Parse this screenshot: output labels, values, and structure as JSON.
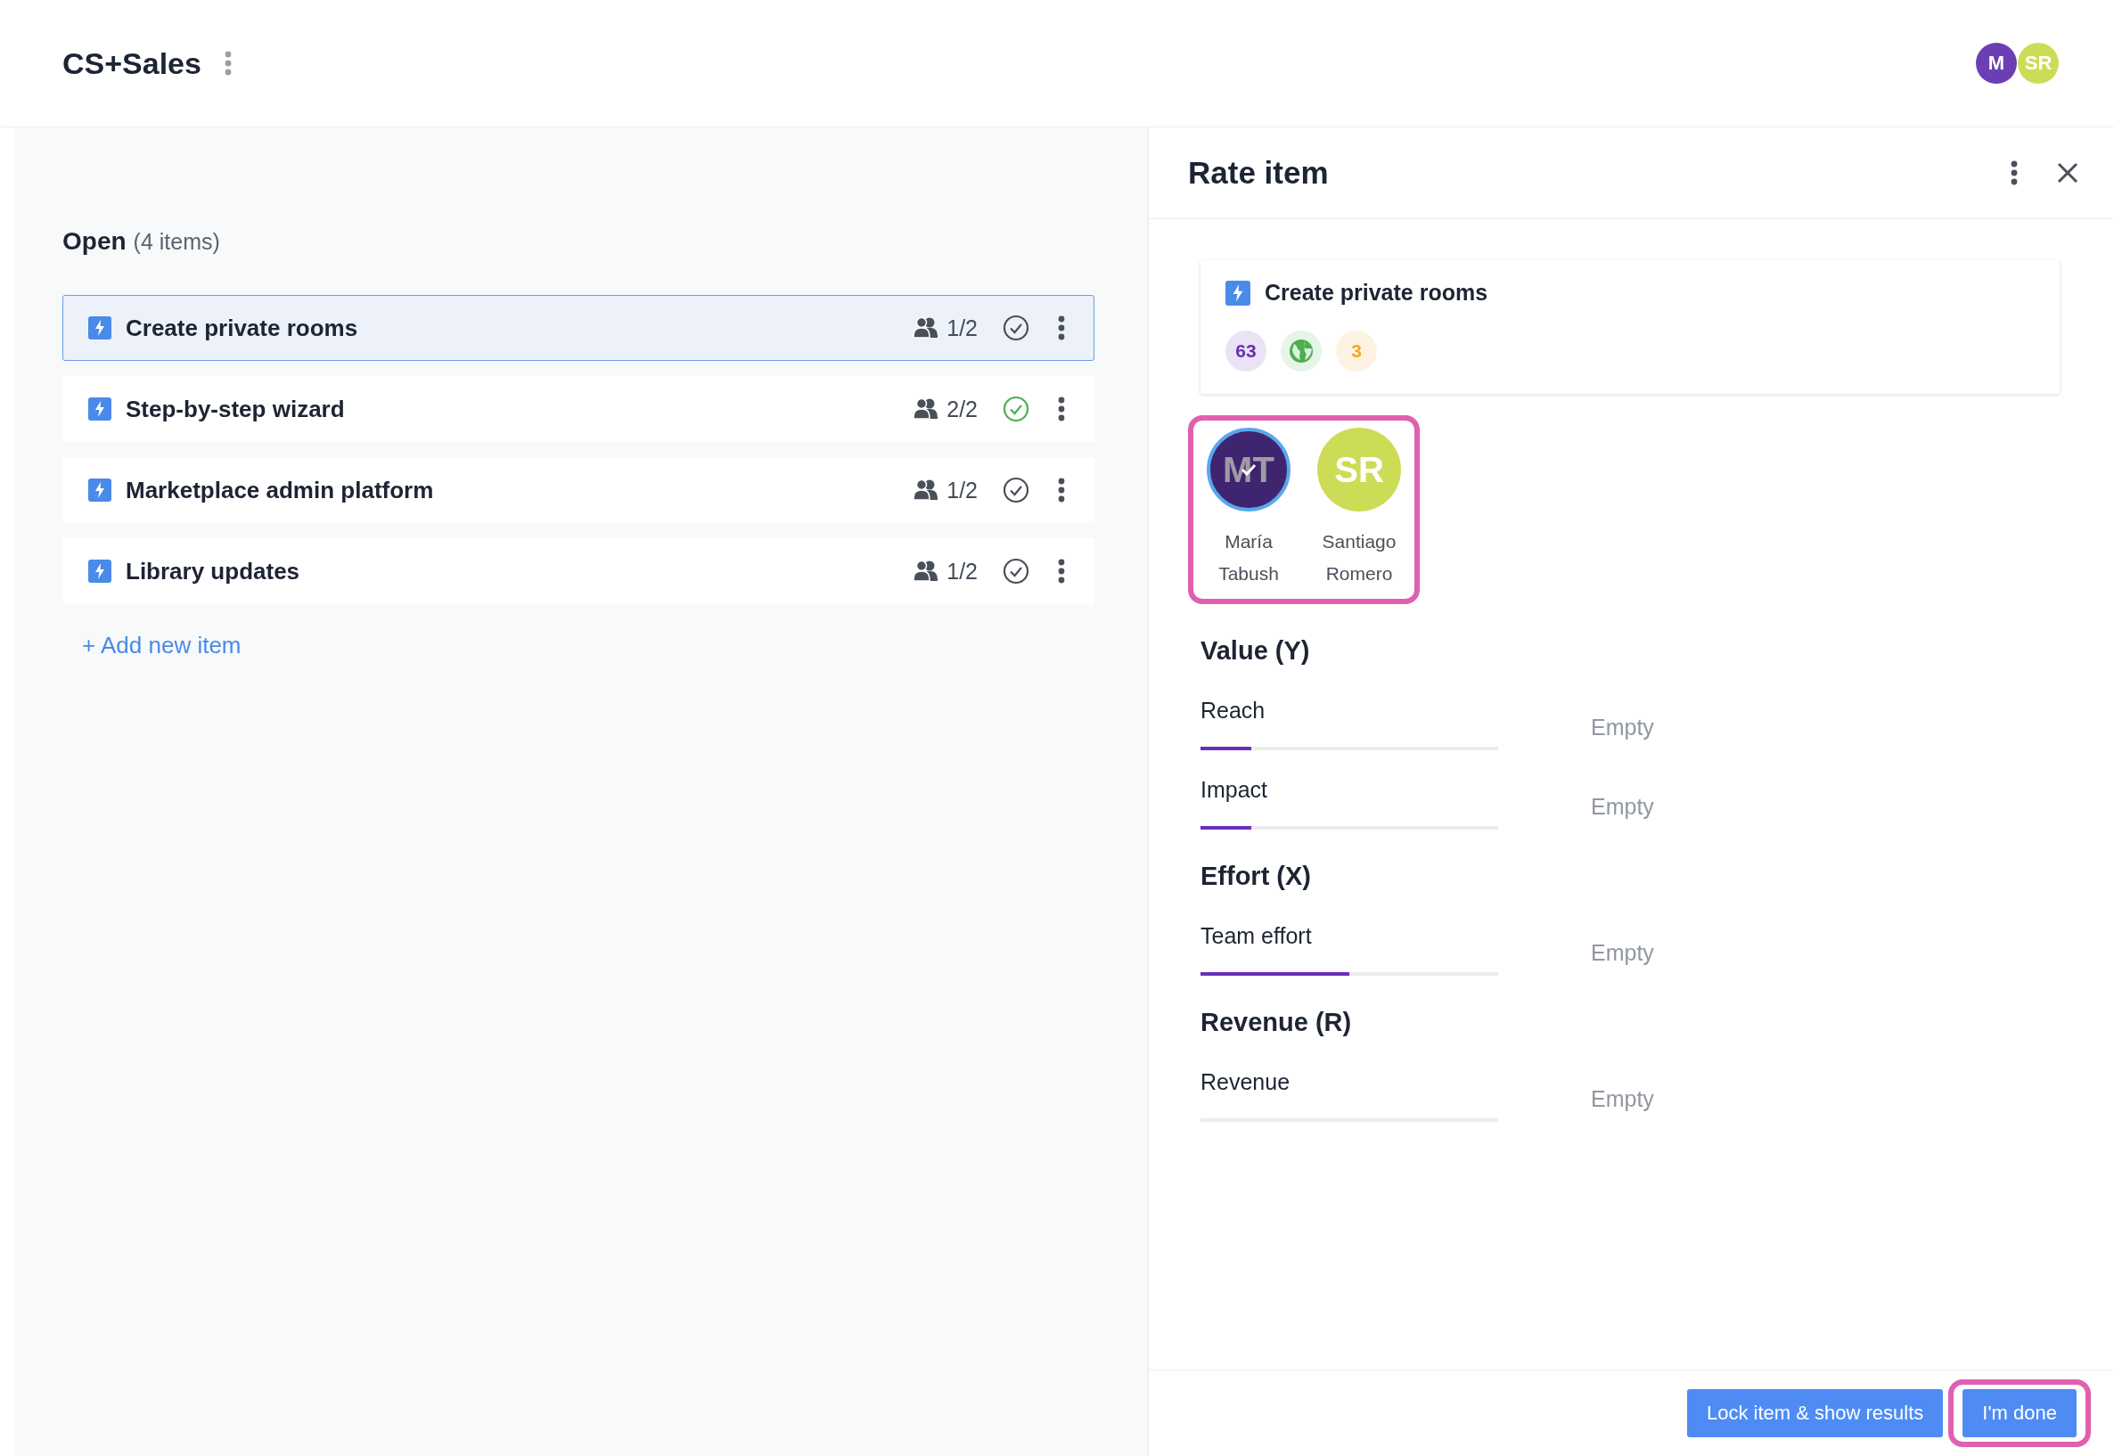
{
  "board": {
    "title": "CS+Sales"
  },
  "header_avatars": [
    {
      "initials": "M",
      "color": "#6b3fb3"
    },
    {
      "initials": "SR",
      "color": "#cddc56"
    }
  ],
  "list": {
    "heading": "Open",
    "count": "(4 items)",
    "items": [
      {
        "title": "Create private rooms",
        "votes": "1/2",
        "done": false,
        "selected": true
      },
      {
        "title": "Step-by-step wizard",
        "votes": "2/2",
        "done": true,
        "selected": false
      },
      {
        "title": "Marketplace admin platform",
        "votes": "1/2",
        "done": false,
        "selected": false
      },
      {
        "title": "Library updates",
        "votes": "1/2",
        "done": false,
        "selected": false
      }
    ],
    "add_link": "+ Add new item"
  },
  "panel": {
    "title": "Rate item",
    "card": {
      "title": "Create private rooms",
      "badges": [
        {
          "kind": "number",
          "text": "63",
          "color": "#6b2fb3"
        },
        {
          "kind": "globe",
          "color": "#4caf50"
        },
        {
          "kind": "number",
          "text": "3",
          "color": "#f5a623"
        }
      ]
    },
    "raters": [
      {
        "initials": "MT",
        "first": "María",
        "last": "Tabush",
        "color": "#3f2470",
        "rated": true
      },
      {
        "initials": "SR",
        "first": "Santiago",
        "last": "Romero",
        "color": "#cddc56",
        "rated": false
      }
    ],
    "sections": [
      {
        "title": "Value (Y)",
        "fields": [
          {
            "label": "Reach",
            "level": 0.17,
            "value": "Empty"
          },
          {
            "label": "Impact",
            "level": 0.17,
            "value": "Empty"
          }
        ]
      },
      {
        "title": "Effort (X)",
        "fields": [
          {
            "label": "Team effort",
            "level": 0.5,
            "value": "Empty"
          }
        ]
      },
      {
        "title": "Revenue (R)",
        "fields": [
          {
            "label": "Revenue",
            "value": "Empty"
          }
        ]
      }
    ],
    "buttons": [
      {
        "label": "Lock item & show results",
        "highlighted": false
      },
      {
        "label": "I'm done",
        "highlighted": true
      }
    ]
  }
}
